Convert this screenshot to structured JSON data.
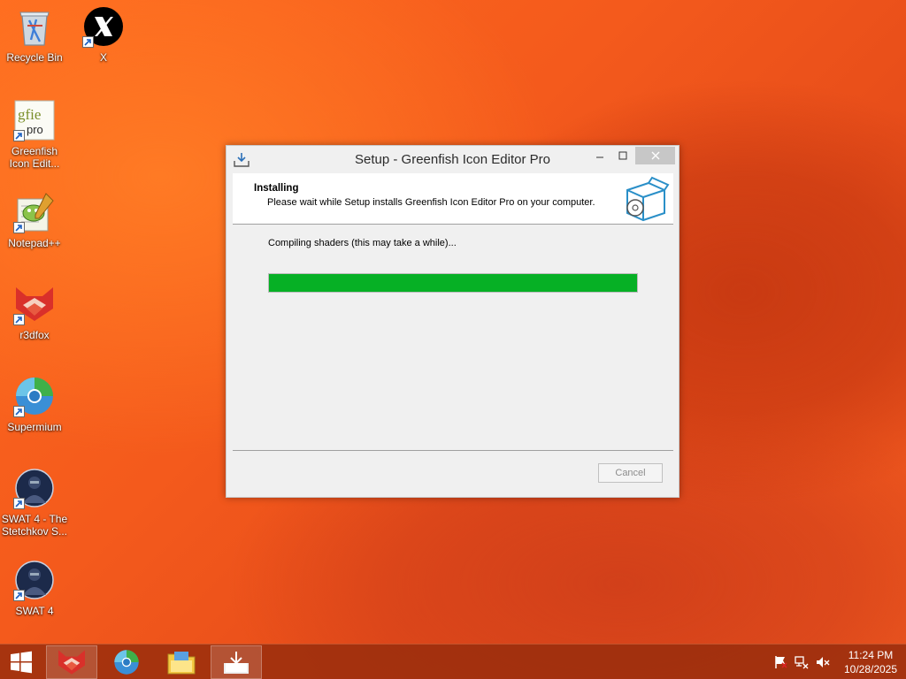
{
  "desktop": {
    "icons": [
      {
        "label": "Recycle Bin",
        "icon": "recycle-bin-icon"
      },
      {
        "label": "X",
        "icon": "x-app-icon"
      },
      {
        "label": "Greenfish Icon Edit...",
        "icon": "greenfish-icon"
      },
      {
        "label": "Notepad++",
        "icon": "notepad-plus-plus-icon"
      },
      {
        "label": "r3dfox",
        "icon": "r3dfox-icon"
      },
      {
        "label": "Supermium",
        "icon": "supermium-icon"
      },
      {
        "label": "SWAT 4 - The Stetchkov S...",
        "icon": "swat4-icon"
      },
      {
        "label": "SWAT 4",
        "icon": "swat4-icon"
      }
    ]
  },
  "window": {
    "title": "Setup - Greenfish Icon Editor Pro",
    "header_title": "Installing",
    "header_subtitle": "Please wait while Setup installs Greenfish Icon Editor Pro on your computer.",
    "status": "Compiling shaders (this may take a while)...",
    "progress_percent": 100,
    "cancel_label": "Cancel"
  },
  "taskbar": {
    "apps": [
      "r3dfox-icon",
      "supermium-icon",
      "file-explorer-icon",
      "setup-installer-icon"
    ],
    "tray_icons": [
      "action-center-flag-icon",
      "network-icon",
      "volume-muted-icon"
    ],
    "time": "11:24 PM",
    "date": "10/28/2025"
  },
  "colors": {
    "progress": "#06b025",
    "accent": "#f05a1c"
  }
}
